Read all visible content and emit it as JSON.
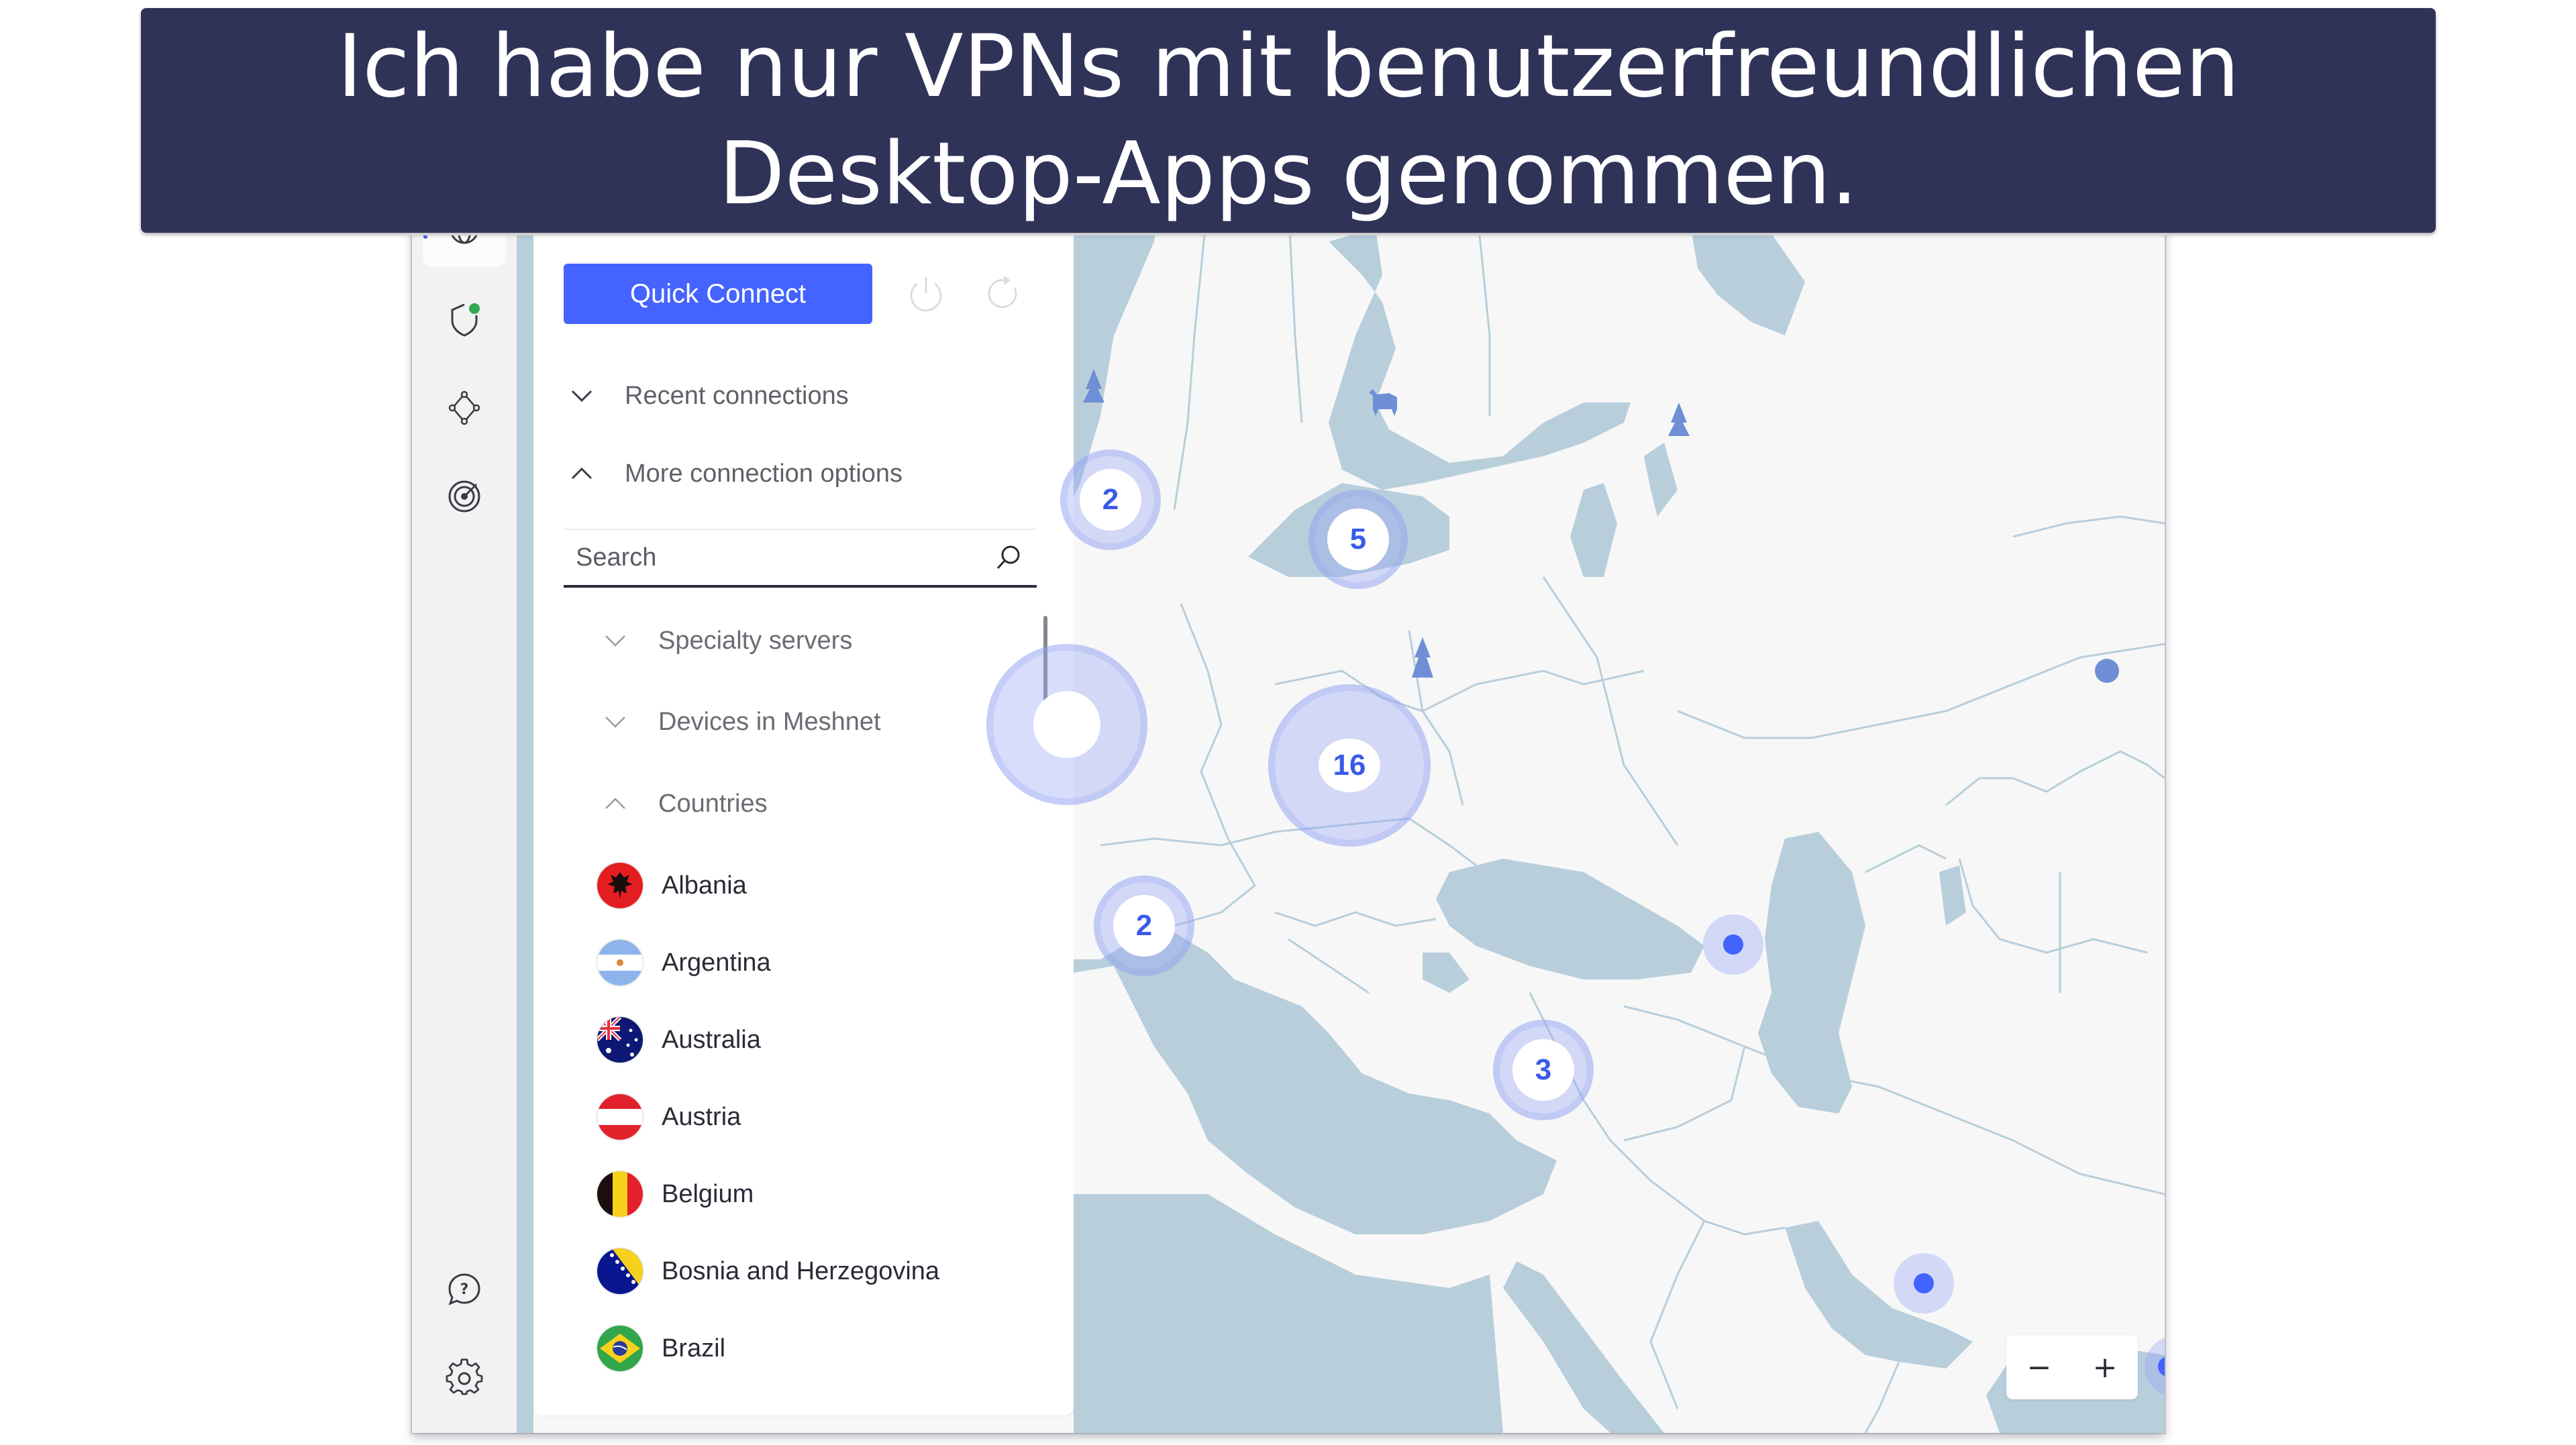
{
  "banner": {
    "line1": "Ich habe nur VPNs mit benutzerfreundlichen",
    "line2": "Desktop-Apps genommen."
  },
  "sidebar": {
    "items": [
      {
        "name": "globe",
        "active": true
      },
      {
        "name": "shield",
        "status": "connected-dot"
      },
      {
        "name": "meshnet"
      },
      {
        "name": "threat-protection"
      }
    ],
    "bottom": [
      {
        "name": "help"
      },
      {
        "name": "settings"
      }
    ]
  },
  "panel": {
    "quick_connect_label": "Quick Connect",
    "recent_connections": "Recent connections",
    "more_options": "More connection options",
    "search_placeholder": "Search",
    "sections": [
      {
        "label": "Specialty servers",
        "expanded": false
      },
      {
        "label": "Devices in Meshnet",
        "expanded": false
      },
      {
        "label": "Countries",
        "expanded": true
      }
    ],
    "countries": [
      {
        "name": "Albania",
        "flag": "albania"
      },
      {
        "name": "Argentina",
        "flag": "argentina"
      },
      {
        "name": "Australia",
        "flag": "australia"
      },
      {
        "name": "Austria",
        "flag": "austria"
      },
      {
        "name": "Belgium",
        "flag": "belgium"
      },
      {
        "name": "Bosnia and Herzegovina",
        "flag": "bosnia"
      },
      {
        "name": "Brazil",
        "flag": "brazil"
      }
    ]
  },
  "map": {
    "clusters": [
      {
        "label": "2",
        "region": "Norway/UK"
      },
      {
        "label": "5",
        "region": "Baltics"
      },
      {
        "label": "16",
        "region": "Central Europe"
      },
      {
        "label": "2",
        "region": "Italy"
      },
      {
        "label": "3",
        "region": "Eastern Mediterranean"
      }
    ],
    "pins": [
      {
        "region": "Caucasus"
      },
      {
        "region": "UAE"
      }
    ],
    "zoom_out": "−",
    "zoom_in": "+"
  },
  "colors": {
    "accent": "#4463ff",
    "banner_bg": "#303358",
    "water": "#b8cedb",
    "land": "#f7f7f7",
    "status_green": "#34a853"
  }
}
